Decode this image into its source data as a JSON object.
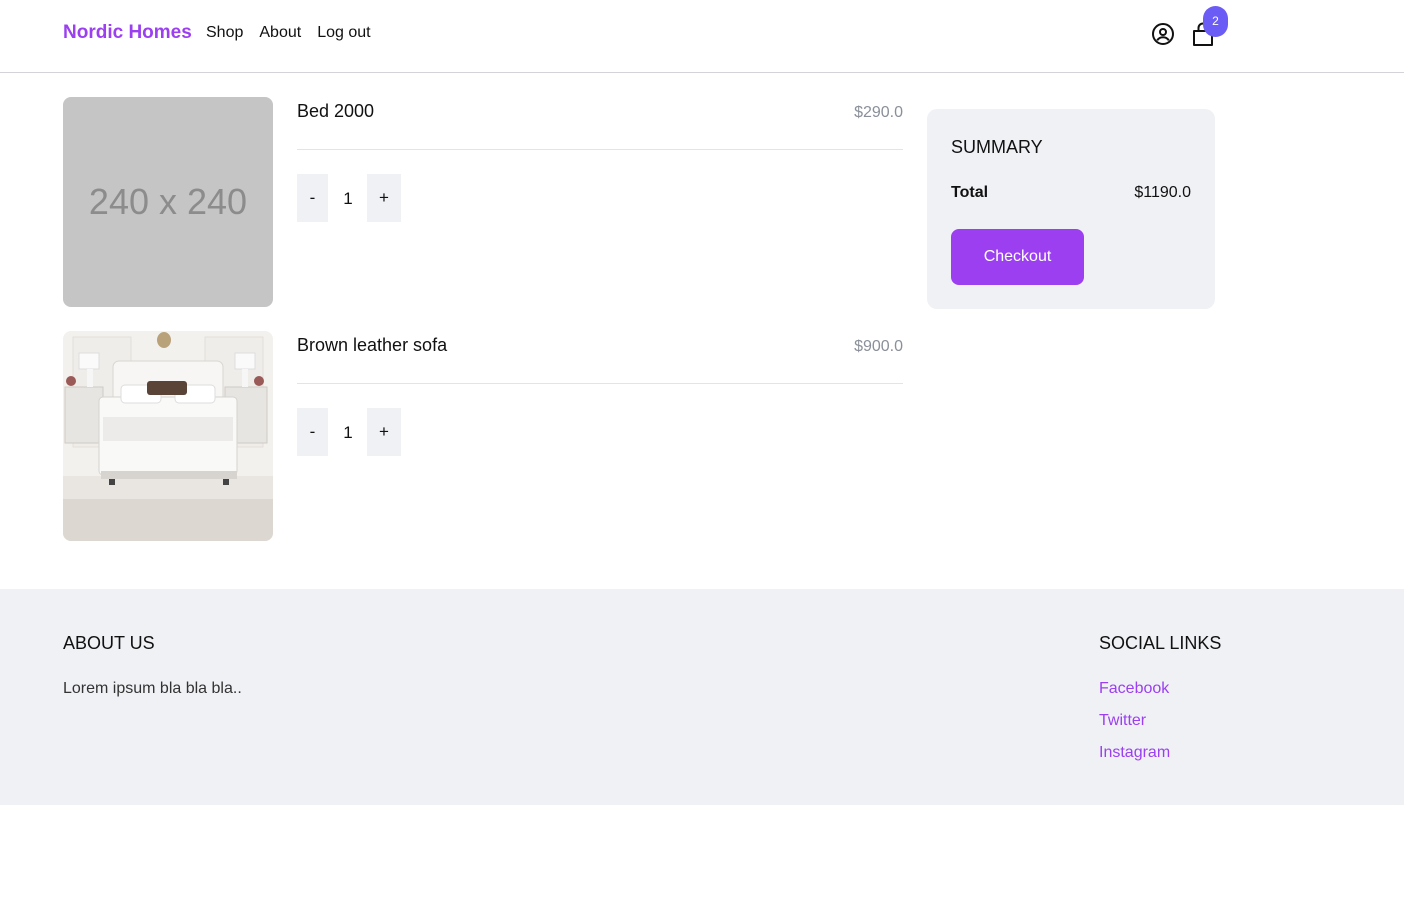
{
  "header": {
    "brand": "Nordic Homes",
    "nav": [
      "Shop",
      "About",
      "Log out"
    ],
    "cart_count": "2"
  },
  "cart": {
    "items": [
      {
        "name": "Bed 2000",
        "price": "$290.0",
        "quantity": "1",
        "image_placeholder": "240 x 240"
      },
      {
        "name": "Brown leather sofa",
        "price": "$900.0",
        "quantity": "1"
      }
    ],
    "decrement_label": "-",
    "increment_label": "+"
  },
  "summary": {
    "title": "SUMMARY",
    "total_label": "Total",
    "total_value": "$1190.0",
    "checkout_label": "Checkout"
  },
  "footer": {
    "about_title": "ABOUT US",
    "about_text": "Lorem ipsum bla bla bla..",
    "social_title": "SOCIAL LINKS",
    "social_links": [
      "Facebook",
      "Twitter",
      "Instagram"
    ]
  },
  "colors": {
    "accent": "#9b3ff0",
    "badge": "#6b5cf5",
    "panel": "#f0f1f5",
    "muted_price": "#8a8f99"
  }
}
